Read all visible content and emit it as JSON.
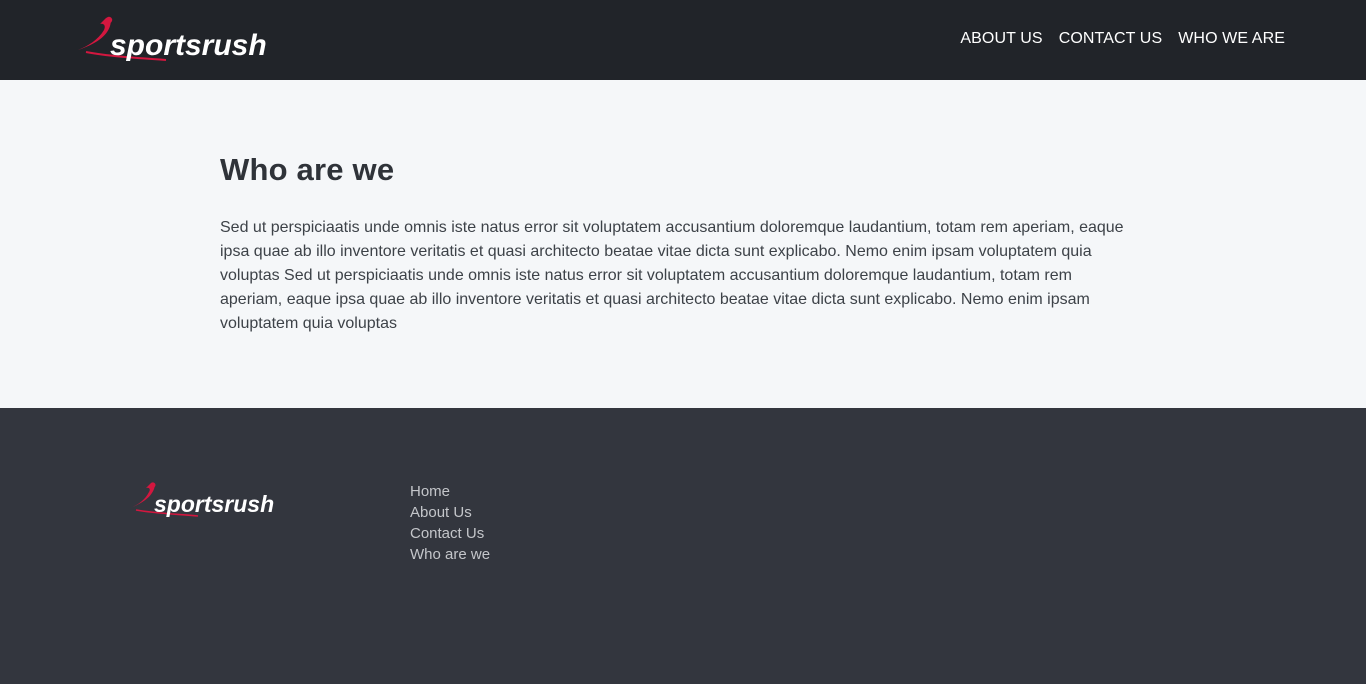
{
  "brand": {
    "name": "sportsrush",
    "accent_color": "#d3173f"
  },
  "header": {
    "nav": [
      {
        "label": "ABOUT US"
      },
      {
        "label": "CONTACT US"
      },
      {
        "label": "WHO WE ARE"
      }
    ]
  },
  "main": {
    "title": "Who are we",
    "body": "Sed ut perspiciaatis unde omnis iste natus error sit voluptatem accusantium doloremque laudantium, totam rem aperiam, eaque ipsa quae ab illo inventore veritatis et quasi architecto beatae vitae dicta sunt explicabo. Nemo enim ipsam voluptatem quia voluptas Sed ut perspiciaatis unde omnis iste natus error sit voluptatem accusantium doloremque laudantium, totam rem aperiam, eaque ipsa quae ab illo inventore veritatis et quasi architecto beatae vitae dicta sunt explicabo. Nemo enim ipsam voluptatem quia voluptas"
  },
  "footer": {
    "links": [
      {
        "label": "Home"
      },
      {
        "label": "About Us"
      },
      {
        "label": "Contact Us"
      },
      {
        "label": "Who are we"
      }
    ]
  }
}
